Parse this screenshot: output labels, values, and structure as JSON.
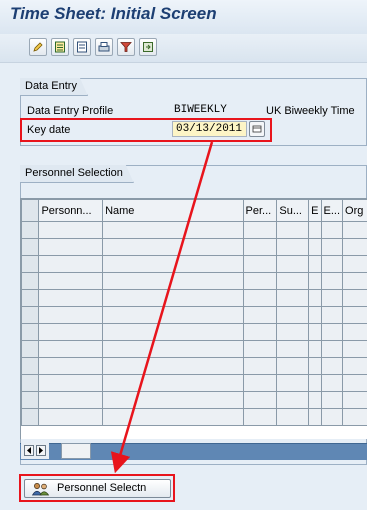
{
  "window": {
    "title": "Time Sheet: Initial Screen"
  },
  "toolbar": {
    "icons": [
      "pencil-icon",
      "form-icon",
      "list-icon",
      "print-icon",
      "filter-icon",
      "export-icon"
    ]
  },
  "data_entry": {
    "group_title": "Data Entry",
    "profile_label": "Data Entry Profile",
    "profile_value": "BIWEEKLY",
    "profile_text": "UK Biweekly Time",
    "keydate_label": "Key date",
    "keydate_value": "03/13/2011"
  },
  "personnel_selection": {
    "group_title": "Personnel Selection",
    "columns": [
      "Personn...",
      "Name",
      "Per...",
      "Su...",
      "E",
      "E...",
      "Org"
    ],
    "row_count": 12
  },
  "button": {
    "label": "Personnel Selectn"
  },
  "annotation": {
    "color": "#e8141c"
  }
}
